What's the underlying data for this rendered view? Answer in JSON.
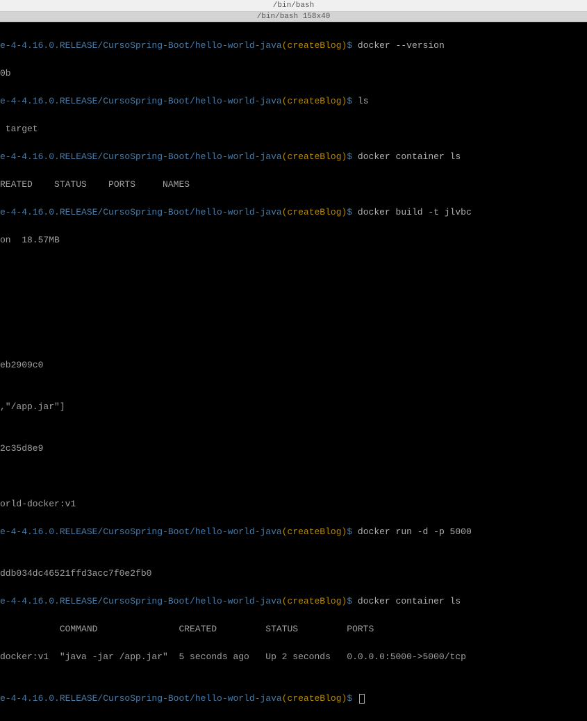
{
  "window": {
    "title": "/bin/bash",
    "subtitle": "/bin/bash 158x40"
  },
  "prompt": {
    "path": "e-4-4.16.0.RELEASE/CursoSpring-Boot/hello-world-java",
    "branch_open": "(",
    "branch": "createBlog",
    "branch_close": ")",
    "dollar": "$"
  },
  "lines": {
    "cmd1": " docker --version",
    "out1": "0b",
    "cmd2": " ls",
    "out2": " target",
    "cmd3": " docker container ls",
    "out3": "REATED    STATUS    PORTS     NAMES",
    "cmd4": " docker build -t jlvbc",
    "out4": "on  18.57MB",
    "blank": "",
    "out5": "eb2909c0",
    "out6": ",\"/app.jar\"]",
    "out7": "2c35d8e9",
    "out8": "orld-docker:v1",
    "cmd5": " docker run -d -p 5000",
    "out9": "ddb034dc46521ffd3acc7f0e2fb0",
    "cmd6": " docker container ls",
    "out10": "           COMMAND               CREATED         STATUS         PORTS",
    "out11": "docker:v1  \"java -jar /app.jar\"  5 seconds ago   Up 2 seconds   0.0.0.0:5000->5000/tcp"
  }
}
